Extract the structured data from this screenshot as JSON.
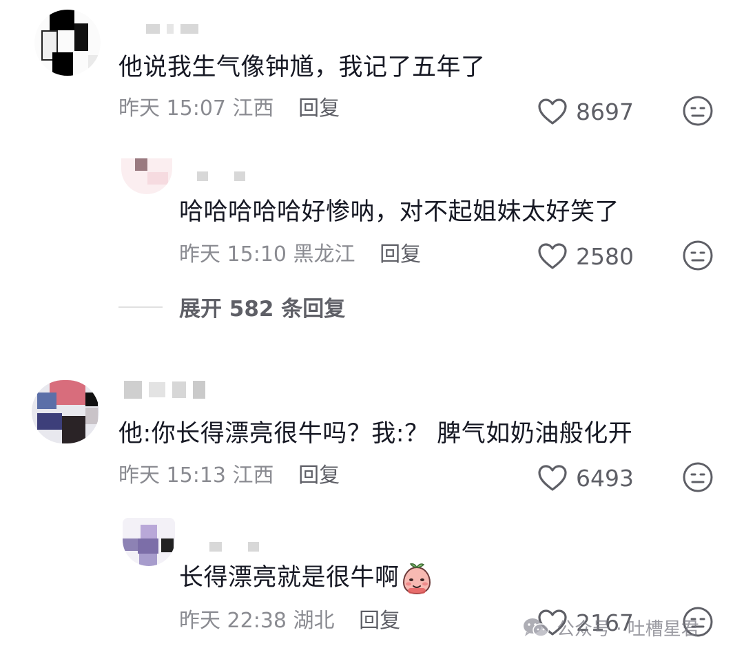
{
  "comments": [
    {
      "text": "他说我生气像钟馗，我记了五年了",
      "time": "昨天 15:07",
      "location": "江西",
      "reply_label": "回复",
      "likes": "8697",
      "replies": [
        {
          "text": "哈哈哈哈哈好惨呐，对不起姐妹太好笑了",
          "time": "昨天 15:10",
          "location": "黑龙江",
          "reply_label": "回复",
          "likes": "2580"
        }
      ],
      "expand_label": "展开 582 条回复"
    },
    {
      "text": "他:你长得漂亮很牛吗？我:？ 脾气如奶油般化开",
      "time": "昨天 15:13",
      "location": "江西",
      "reply_label": "回复",
      "likes": "6493",
      "replies": [
        {
          "text": "长得漂亮就是很牛啊",
          "time": "昨天 22:38",
          "location": "湖北",
          "reply_label": "回复",
          "likes": "2167"
        }
      ]
    }
  ],
  "icons": {
    "like": "heart-outline-icon",
    "dislike": "neutral-face-icon",
    "sticker": "peach-sticker-icon",
    "watermark": "wechat-icon"
  },
  "watermark": {
    "text": "公众号 · 吐槽星君"
  },
  "colors": {
    "text": "#161823",
    "meta": "#8a8b91",
    "action": "#5e5f66",
    "background": "#ffffff"
  }
}
